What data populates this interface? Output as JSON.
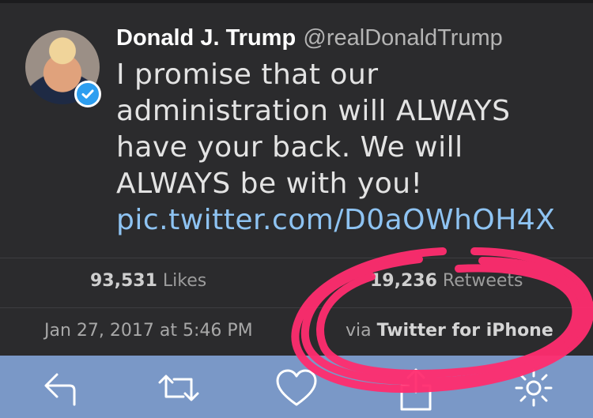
{
  "tweet": {
    "display_name": "Donald J. Trump",
    "handle": "@realDonaldTrump",
    "text": "I promise that our administration will ALWAYS have your back. We will ALWAYS be with you!",
    "link": "pic.twitter.com/D0aOWhOH4X"
  },
  "stats": {
    "likes_count": "93,531",
    "likes_label": "Likes",
    "retweets_count": "19,236",
    "retweets_label": "Retweets"
  },
  "meta": {
    "timestamp": "Jan 27, 2017 at 5:46 PM",
    "via_prefix": "via",
    "source": "Twitter for iPhone"
  },
  "icons": {
    "reply": "reply-icon",
    "retweet": "retweet-icon",
    "like": "heart-icon",
    "share": "share-icon",
    "more": "gear-icon"
  },
  "colors": {
    "background": "#2b2b2d",
    "link": "#8ec3f2",
    "action_bar": "#7a98c7",
    "verified": "#2d9ef0",
    "highlight_scribble": "#ff2d6f"
  }
}
